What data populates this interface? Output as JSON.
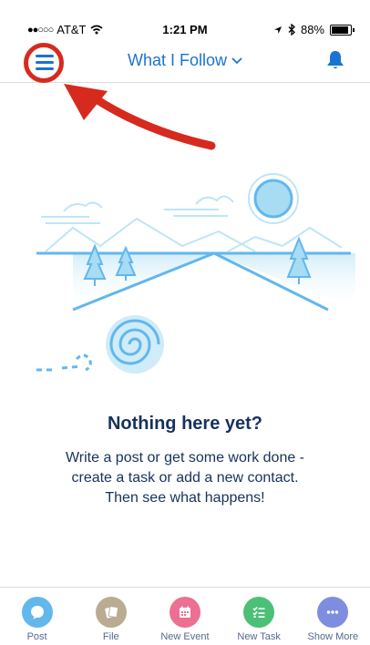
{
  "status": {
    "carrier": "AT&T",
    "time": "1:21 PM",
    "battery": "88%",
    "battery_fraction": 0.88
  },
  "header": {
    "title": "What I Follow"
  },
  "empty_state": {
    "title": "Nothing here yet?",
    "lines": [
      "Write a post or get some work done -",
      "create a task or add a new contact.",
      "Then see what happens!"
    ]
  },
  "actions": [
    {
      "label": "Post",
      "icon": "post-icon",
      "color": "#62b7ed"
    },
    {
      "label": "File",
      "icon": "file-icon",
      "color": "#baac93"
    },
    {
      "label": "New Event",
      "icon": "event-icon",
      "color": "#eb7092"
    },
    {
      "label": "New Task",
      "icon": "task-icon",
      "color": "#4bc076"
    },
    {
      "label": "Show More",
      "icon": "more-icon",
      "color": "#7f8de1"
    }
  ],
  "colors": {
    "brand_blue": "#1b73d1",
    "annotation_red": "#d62a1e",
    "text_navy": "#16325c"
  }
}
